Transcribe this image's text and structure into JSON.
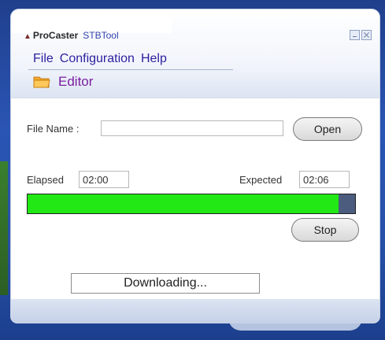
{
  "window": {
    "brand_name": "ProCaster",
    "app_name": "STBTool"
  },
  "menu": {
    "items": [
      {
        "label": "File"
      },
      {
        "label": "Configuration"
      },
      {
        "label": "Help"
      }
    ]
  },
  "section": {
    "title": "Editor",
    "icon": "folder-icon"
  },
  "file_name": {
    "label": "File Name :",
    "value": ""
  },
  "open_button": {
    "label": "Open"
  },
  "elapsed": {
    "label": "Elapsed",
    "value": "02:00"
  },
  "expected": {
    "label": "Expected",
    "value": "02:06"
  },
  "progress": {
    "fraction": 0.95,
    "fill_color": "#22e815",
    "track_color": "#4b5c7e"
  },
  "stop_button": {
    "label": "Stop"
  },
  "status": {
    "text": "Downloading..."
  }
}
